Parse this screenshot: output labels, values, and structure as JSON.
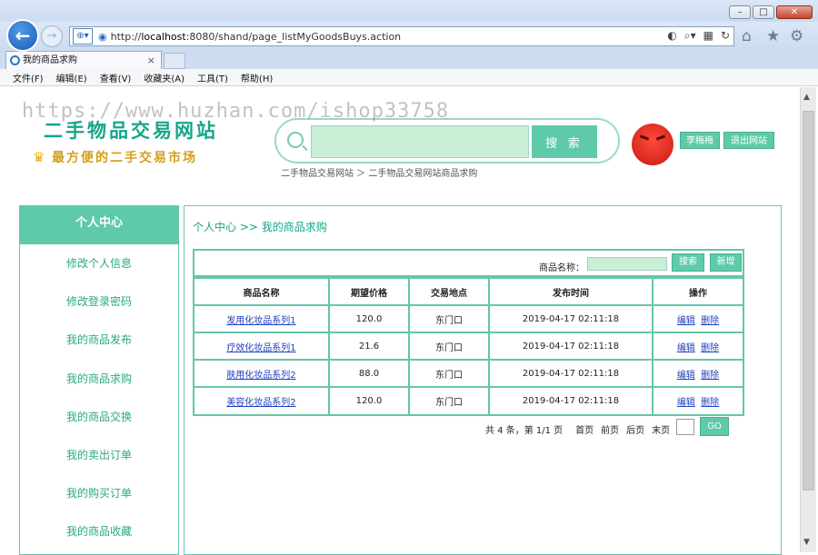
{
  "browser": {
    "url_prefix": "http://",
    "url_host": "localhost",
    "url_rest": ":8080/shand/page_listMyGoodsBuys.action",
    "tab_title": "我的商品求购",
    "menu": [
      "文件(F)",
      "编辑(E)",
      "查看(V)",
      "收藏夹(A)",
      "工具(T)",
      "帮助(H)"
    ]
  },
  "watermark": "https://www.huzhan.com/ishop33758",
  "header": {
    "site_title": "二手物品交易网站",
    "slogan": "最方便的二手交易市场",
    "search_button": "搜 索",
    "search_value": "",
    "breadcrumb": "二手物品交易网站 ＞ 二手物品交易网站商品求购",
    "username": "李梅梅",
    "logout": "退出网站"
  },
  "sidebar": {
    "title": "个人中心",
    "items": [
      "修改个人信息",
      "修改登录密码",
      "我的商品发布",
      "我的商品求购",
      "我的商品交换",
      "我的卖出订单",
      "我的购买订单",
      "我的商品收藏"
    ]
  },
  "main": {
    "crumb": "个人中心 >> 我的商品求购",
    "filter_label": "商品名称：",
    "filter_value": "",
    "search_btn": "搜索",
    "add_btn": "新增",
    "columns": [
      "商品名称",
      "期望价格",
      "交易地点",
      "发布时间",
      "操作"
    ],
    "rows": [
      {
        "name": "发用化妆品系列1",
        "price": "120.0",
        "place": "东门口",
        "time": "2019-04-17 02:11:18",
        "edit": "编辑",
        "del": "删除"
      },
      {
        "name": "疗效化妆品系列1",
        "price": "21.6",
        "place": "东门口",
        "time": "2019-04-17 02:11:18",
        "edit": "编辑",
        "del": "删除"
      },
      {
        "name": "肤用化妆品系列2",
        "price": "88.0",
        "place": "东门口",
        "time": "2019-04-17 02:11:18",
        "edit": "编辑",
        "del": "删除"
      },
      {
        "name": "美容化妆品系列2",
        "price": "120.0",
        "place": "东门口",
        "time": "2019-04-17 02:11:18",
        "edit": "编辑",
        "del": "删除"
      }
    ],
    "pager": {
      "summary": "共 4 条，第 1/1 页",
      "first": "首页",
      "prev": "前页",
      "next": "后页",
      "last": "末页",
      "page_value": "",
      "go": "GO"
    }
  },
  "colors": {
    "accent": "#5ecaa9",
    "title": "#17a589",
    "link": "#1f3fbf"
  }
}
